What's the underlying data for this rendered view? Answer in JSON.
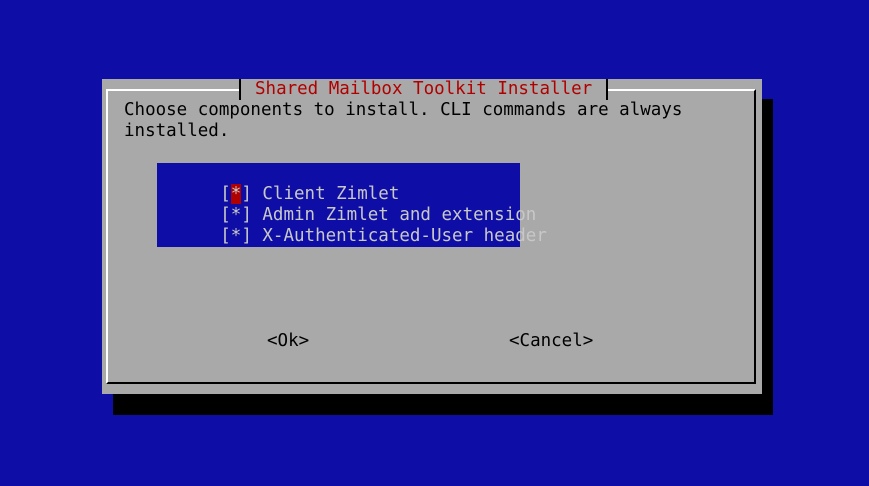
{
  "dialog": {
    "title": "Shared Mailbox Toolkit Installer",
    "prompt": "Choose components to install. CLI commands are always\ninstalled."
  },
  "checklist": {
    "items": [
      {
        "mark": "*",
        "label": "Client Zimlet",
        "checked": true,
        "focused": true
      },
      {
        "mark": "*",
        "label": "Admin Zimlet and extension",
        "checked": true,
        "focused": false
      },
      {
        "mark": "*",
        "label": "X-Authenticated-User header",
        "checked": true,
        "focused": false
      }
    ]
  },
  "buttons": {
    "ok": "<Ok>",
    "cancel": "<Cancel>"
  },
  "colors": {
    "background": "#0e0ea6",
    "dialog": "#a9a9a9",
    "title": "#b00000",
    "list_background": "#0e0ea6",
    "focus_mark": "#b00000"
  }
}
